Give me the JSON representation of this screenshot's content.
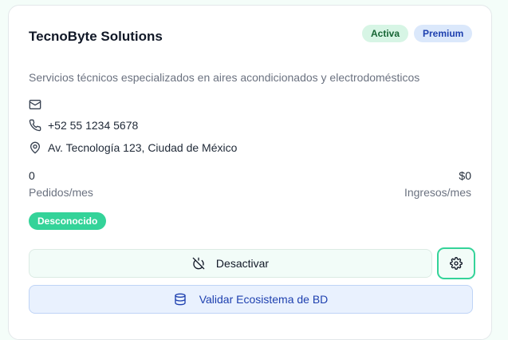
{
  "card": {
    "title": "TecnoByte Solutions",
    "badges": {
      "status": "Activa",
      "tier": "Premium"
    },
    "description": "Servicios técnicos especializados en aires acondicionados y electrodomésticos",
    "contact": {
      "email_icon": "mail-icon",
      "email": "",
      "phone_icon": "phone-icon",
      "phone": "+52 55 1234 5678",
      "address_icon": "map-pin-icon",
      "address": "Av. Tecnología 123, Ciudad de México"
    },
    "stats": {
      "orders": {
        "value": "0",
        "label": "Pedidos/mes"
      },
      "revenue": {
        "value": "$0",
        "label": "Ingresos/mes"
      }
    },
    "ecosystem_status": "Desconocido",
    "actions": {
      "deactivate": {
        "label": "Desactivar",
        "icon": "power-off-icon"
      },
      "settings": {
        "icon": "gear-icon"
      },
      "validate": {
        "label": "Validar Ecosistema de BD",
        "icon": "database-icon"
      }
    }
  },
  "colors": {
    "accent_green": "#34d399",
    "active_badge_bg": "#d7f5e5",
    "premium_badge_bg": "#dbe8fb",
    "link_blue": "#1e40af"
  }
}
